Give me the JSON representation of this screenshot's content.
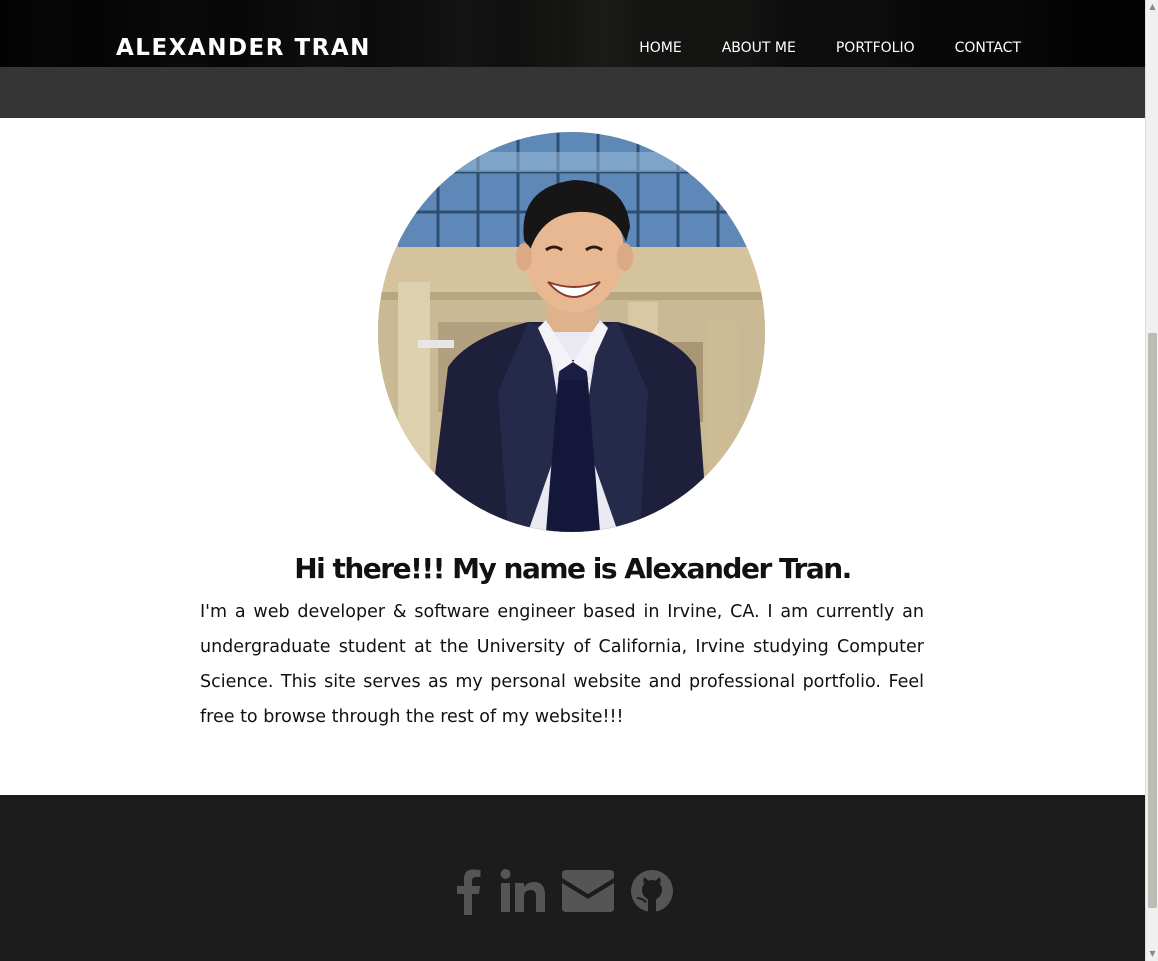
{
  "header": {
    "brand": "ALEXANDER TRAN",
    "nav": [
      "HOME",
      "ABOUT ME",
      "PORTFOLIO",
      "CONTACT"
    ]
  },
  "profile": {
    "photo": "profile-photo",
    "headline": "Hi there!!! My name is Alexander Tran.",
    "bio": "I'm a web developer & software engineer based in Irvine, CA. I am currently an undergraduate student at the University of California, Irvine studying Computer Science. This site serves as my personal website and professional portfolio. Feel free to browse through the rest of my website!!!"
  },
  "footer": {
    "social_icons": [
      "facebook-icon",
      "linkedin-icon",
      "envelope-icon",
      "github-icon"
    ],
    "icon_color": "#555555",
    "background": "#1c1c1c"
  },
  "colors": {
    "nav_text": "#ffffff",
    "hero_band": "#353535",
    "text": "#111111"
  }
}
